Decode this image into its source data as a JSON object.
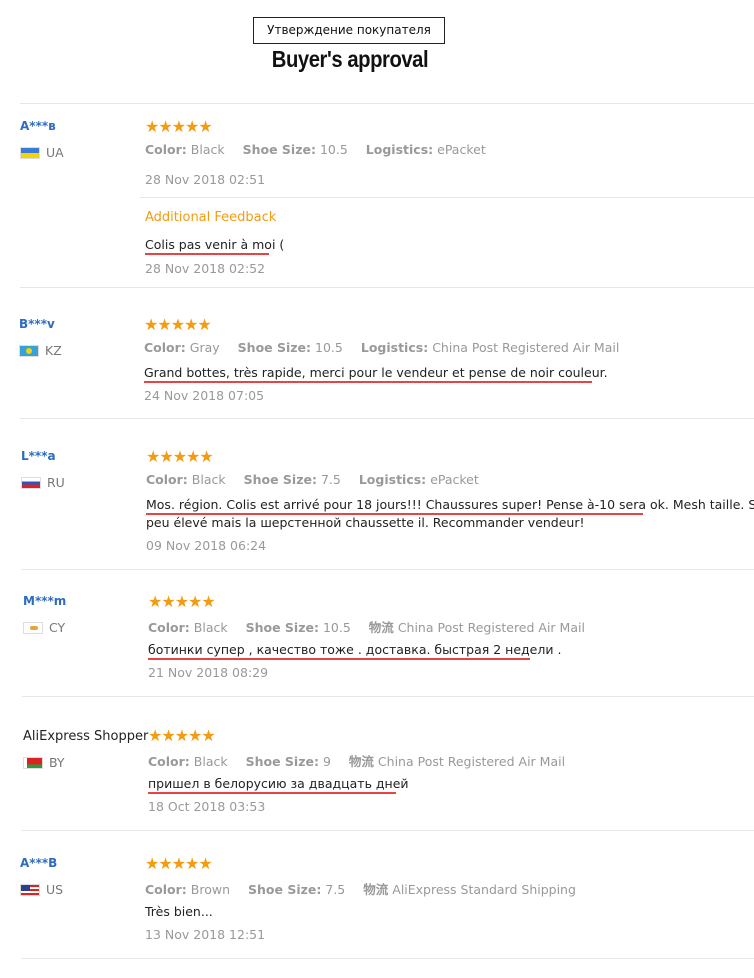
{
  "header": {
    "title_ru": "Утверждение покупателя",
    "title_en": "Buyer's approval"
  },
  "labels": {
    "color": "Color:",
    "shoe_size": "Shoe Size:",
    "logistics": "Logistics:",
    "logistics_cn": "物流",
    "additional_feedback": "Additional Feedback"
  },
  "reviews": [
    {
      "name": "A***в",
      "country": "UA",
      "stars": "★★★★★",
      "color": "Black",
      "size": "10.5",
      "logistics": "ePacket",
      "date": "28 Nov 2018 02:51",
      "additional_text": "Colis pas venir à moi (",
      "additional_date": "28 Nov 2018 02:52"
    },
    {
      "name": "B***v",
      "country": "KZ",
      "stars": "★★★★★",
      "color": "Gray",
      "size": "10.5",
      "logistics": "China Post Registered Air Mail",
      "text": "Grand bottes, très rapide, merci pour le vendeur et pense de noir couleur.",
      "date": "24 Nov 2018 07:05"
    },
    {
      "name": "L***a",
      "country": "RU",
      "stars": "★★★★★",
      "color": "Black",
      "size": "7.5",
      "logistics": "ePacket",
      "text1": "Mos. région. Colis est arrivé pour 18 jours!!! Chaussures super! Pense à-10 sera ok. Mesh taille. Son fi",
      "text2": "peu élevé mais la шерстенной chaussette il. Recommander vendeur!",
      "date": "09 Nov 2018 06:24"
    },
    {
      "name": "M***m",
      "country": "CY",
      "stars": "★★★★★",
      "color": "Black",
      "size": "10.5",
      "logistics": "China Post Registered Air Mail",
      "text": "ботинки супер , качество тоже . доставка. быстрая 2 недели .",
      "date": "21 Nov 2018 08:29"
    },
    {
      "name": "AliExpress Shopper",
      "country": "BY",
      "stars": "★★★★★",
      "color": "Black",
      "size": "9",
      "logistics": "China Post Registered Air Mail",
      "text": "пришел в белорусию за двадцать дней",
      "date": "18 Oct 2018 03:53"
    },
    {
      "name": "A***B",
      "country": "US",
      "stars": "★★★★★",
      "color": "Brown",
      "size": "7.5",
      "logistics": "AliExpress Standard Shipping",
      "text": "Très bien...",
      "date": "13 Nov 2018 12:51"
    }
  ]
}
